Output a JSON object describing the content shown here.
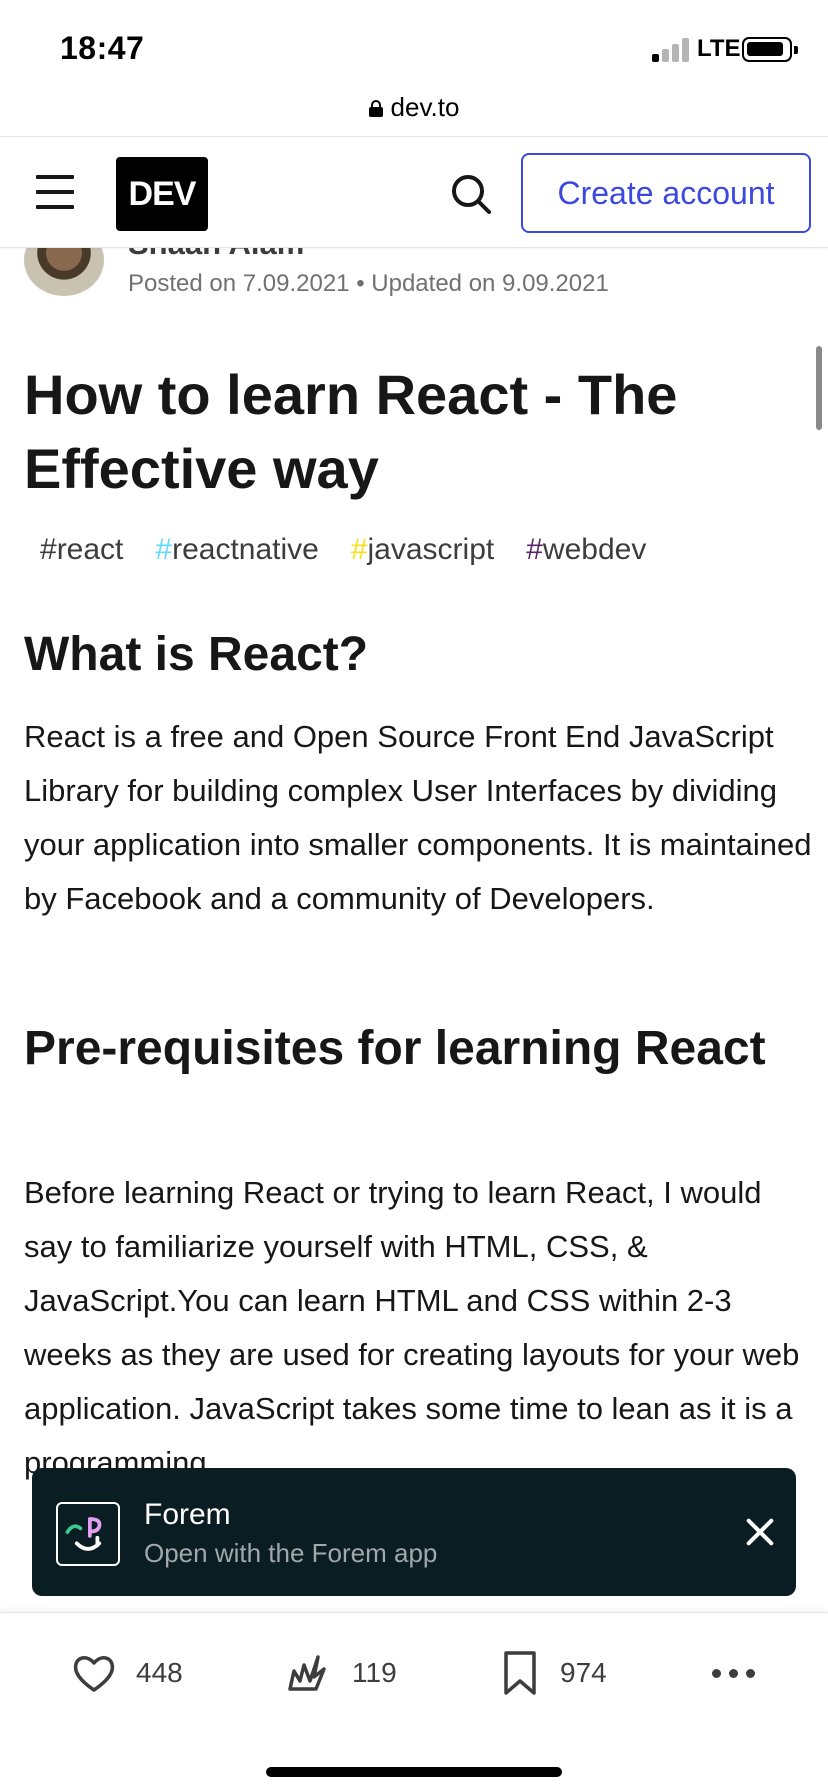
{
  "status_bar": {
    "time": "18:47",
    "network": "LTE"
  },
  "url_bar": {
    "domain": "dev.to",
    "icon": "lock-icon"
  },
  "header": {
    "menu_icon": "hamburger-icon",
    "logo_text": "DEV",
    "search_icon": "search-icon",
    "create_account_label": "Create account",
    "accent_color": "#3b49df"
  },
  "article": {
    "author_name": "Shaan Alam",
    "posted_on": "Posted on 7.09.2021",
    "separator": "•",
    "updated_on": "Updated on 9.09.2021",
    "title": "How to learn React - The Effective way",
    "tags": [
      {
        "hash": "#",
        "name": "react",
        "hash_color": "#3d3d3d"
      },
      {
        "hash": "#",
        "name": "reactnative",
        "hash_color": "#61dafb"
      },
      {
        "hash": "#",
        "name": "javascript",
        "hash_color": "#f7df1e"
      },
      {
        "hash": "#",
        "name": "webdev",
        "hash_color": "#562765"
      }
    ],
    "sections": [
      {
        "heading": "What is React?",
        "body": "React is a free and Open Source Front End JavaScript Library for building complex User Interfaces by dividing your application into smaller components. It is maintained by Facebook and a community of Developers."
      },
      {
        "heading": "Pre-requisites for learning React",
        "body": "Before learning React or trying to learn React, I would say to familiarize yourself with HTML, CSS, & JavaScript.You can learn HTML and CSS within 2-3 weeks as they are used for creating layouts for your web application. JavaScript takes some time to lean as it is a programming"
      }
    ]
  },
  "forem_banner": {
    "title": "Forem",
    "subtitle": "Open with the Forem app",
    "close_icon": "close-icon"
  },
  "actions": {
    "likes": "448",
    "unicorns": "119",
    "bookmarks": "974",
    "more_icon": "more-icon"
  }
}
